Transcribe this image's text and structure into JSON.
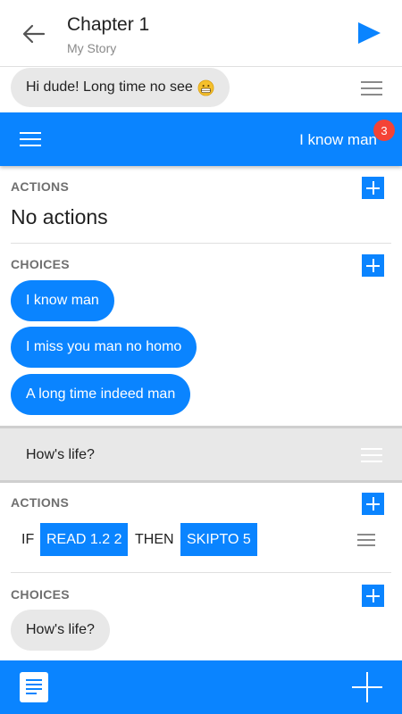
{
  "header": {
    "title": "Chapter 1",
    "subtitle": "My Story",
    "back_icon": "arrow-left-icon",
    "play_icon": "play-icon"
  },
  "message_1": {
    "text": "Hi dude! Long time no see",
    "emoji": "grinning-face-emoji"
  },
  "selected_bar": {
    "label": "I know man",
    "badge": "3"
  },
  "block_1": {
    "actions_label": "ACTIONS",
    "actions_empty": "No actions",
    "choices_label": "CHOICES",
    "choices": [
      "I know man",
      "I miss you man no homo",
      "A long time indeed man"
    ]
  },
  "message_2": {
    "text": "How's life?"
  },
  "block_2": {
    "actions_label": "ACTIONS",
    "condition": {
      "if": "IF",
      "condition_value": "READ 1.2 2",
      "then": "THEN",
      "action_value": "SKIPTO 5"
    },
    "choices_label": "CHOICES",
    "choices": [
      "How's life?"
    ]
  },
  "bottom_bar": {
    "left_icon": "document-icon",
    "right_icon": "plus-icon"
  },
  "colors": {
    "accent": "#0a84ff",
    "badge": "#f44336",
    "bubble_gray": "#e8e8e8"
  }
}
